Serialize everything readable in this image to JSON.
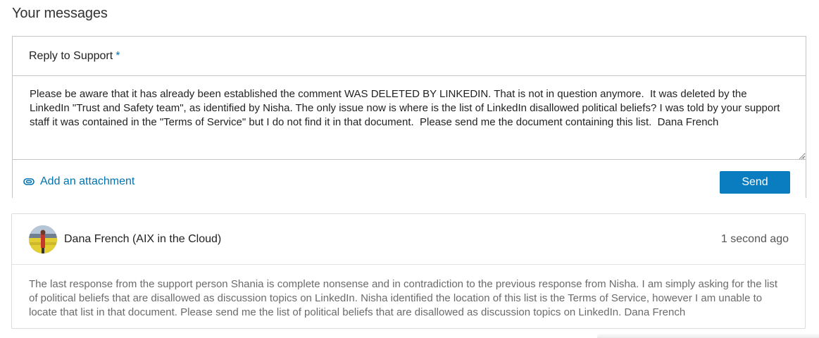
{
  "page": {
    "title": "Your messages"
  },
  "reply": {
    "header_label": "Reply to Support",
    "required_marker": "*",
    "body_text": "Please be aware that it has already been established the comment WAS DELETED BY LINKEDIN. That is not in question anymore.  It was deleted by the LinkedIn \"Trust and Safety team\", as identified by Nisha. The only issue now is where is the list of LinkedIn disallowed political beliefs? I was told by your support staff it was contained in the \"Terms of Service\" but I do not find it in that document.  Please send me the document containing this list.  Dana French",
    "attachment_label": "Add an attachment",
    "attachment_icon": "paperclip-icon",
    "send_label": "Send"
  },
  "message": {
    "sender": "Dana French (AIX in the Cloud)",
    "timestamp": "1 second ago",
    "body": "The last response from the support person Shania is complete nonsense and in contradiction to the previous response from Nisha. I am simply asking for the list of political beliefs that are disallowed as discussion topics on LinkedIn. Nisha identified the location of this list is the Terms of Service, however I am unable to locate that list in that document. Please send me the list of political beliefs that are disallowed as discussion topics on LinkedIn. Dana French",
    "avatar_icon": "user-avatar"
  },
  "colors": {
    "accent": "#0073b1",
    "send_button": "#0a7cc0",
    "border": "#c6c6c6",
    "muted_text": "#6b6b6b"
  }
}
